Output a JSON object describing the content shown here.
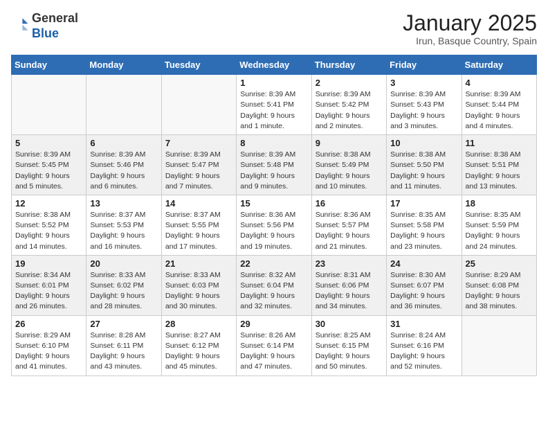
{
  "header": {
    "logo_line1": "General",
    "logo_line2": "Blue",
    "month": "January 2025",
    "location": "Irun, Basque Country, Spain"
  },
  "days_of_week": [
    "Sunday",
    "Monday",
    "Tuesday",
    "Wednesday",
    "Thursday",
    "Friday",
    "Saturday"
  ],
  "weeks": [
    [
      {
        "day": "",
        "info": ""
      },
      {
        "day": "",
        "info": ""
      },
      {
        "day": "",
        "info": ""
      },
      {
        "day": "1",
        "info": "Sunrise: 8:39 AM\nSunset: 5:41 PM\nDaylight: 9 hours\nand 1 minute."
      },
      {
        "day": "2",
        "info": "Sunrise: 8:39 AM\nSunset: 5:42 PM\nDaylight: 9 hours\nand 2 minutes."
      },
      {
        "day": "3",
        "info": "Sunrise: 8:39 AM\nSunset: 5:43 PM\nDaylight: 9 hours\nand 3 minutes."
      },
      {
        "day": "4",
        "info": "Sunrise: 8:39 AM\nSunset: 5:44 PM\nDaylight: 9 hours\nand 4 minutes."
      }
    ],
    [
      {
        "day": "5",
        "info": "Sunrise: 8:39 AM\nSunset: 5:45 PM\nDaylight: 9 hours\nand 5 minutes."
      },
      {
        "day": "6",
        "info": "Sunrise: 8:39 AM\nSunset: 5:46 PM\nDaylight: 9 hours\nand 6 minutes."
      },
      {
        "day": "7",
        "info": "Sunrise: 8:39 AM\nSunset: 5:47 PM\nDaylight: 9 hours\nand 7 minutes."
      },
      {
        "day": "8",
        "info": "Sunrise: 8:39 AM\nSunset: 5:48 PM\nDaylight: 9 hours\nand 9 minutes."
      },
      {
        "day": "9",
        "info": "Sunrise: 8:38 AM\nSunset: 5:49 PM\nDaylight: 9 hours\nand 10 minutes."
      },
      {
        "day": "10",
        "info": "Sunrise: 8:38 AM\nSunset: 5:50 PM\nDaylight: 9 hours\nand 11 minutes."
      },
      {
        "day": "11",
        "info": "Sunrise: 8:38 AM\nSunset: 5:51 PM\nDaylight: 9 hours\nand 13 minutes."
      }
    ],
    [
      {
        "day": "12",
        "info": "Sunrise: 8:38 AM\nSunset: 5:52 PM\nDaylight: 9 hours\nand 14 minutes."
      },
      {
        "day": "13",
        "info": "Sunrise: 8:37 AM\nSunset: 5:53 PM\nDaylight: 9 hours\nand 16 minutes."
      },
      {
        "day": "14",
        "info": "Sunrise: 8:37 AM\nSunset: 5:55 PM\nDaylight: 9 hours\nand 17 minutes."
      },
      {
        "day": "15",
        "info": "Sunrise: 8:36 AM\nSunset: 5:56 PM\nDaylight: 9 hours\nand 19 minutes."
      },
      {
        "day": "16",
        "info": "Sunrise: 8:36 AM\nSunset: 5:57 PM\nDaylight: 9 hours\nand 21 minutes."
      },
      {
        "day": "17",
        "info": "Sunrise: 8:35 AM\nSunset: 5:58 PM\nDaylight: 9 hours\nand 23 minutes."
      },
      {
        "day": "18",
        "info": "Sunrise: 8:35 AM\nSunset: 5:59 PM\nDaylight: 9 hours\nand 24 minutes."
      }
    ],
    [
      {
        "day": "19",
        "info": "Sunrise: 8:34 AM\nSunset: 6:01 PM\nDaylight: 9 hours\nand 26 minutes."
      },
      {
        "day": "20",
        "info": "Sunrise: 8:33 AM\nSunset: 6:02 PM\nDaylight: 9 hours\nand 28 minutes."
      },
      {
        "day": "21",
        "info": "Sunrise: 8:33 AM\nSunset: 6:03 PM\nDaylight: 9 hours\nand 30 minutes."
      },
      {
        "day": "22",
        "info": "Sunrise: 8:32 AM\nSunset: 6:04 PM\nDaylight: 9 hours\nand 32 minutes."
      },
      {
        "day": "23",
        "info": "Sunrise: 8:31 AM\nSunset: 6:06 PM\nDaylight: 9 hours\nand 34 minutes."
      },
      {
        "day": "24",
        "info": "Sunrise: 8:30 AM\nSunset: 6:07 PM\nDaylight: 9 hours\nand 36 minutes."
      },
      {
        "day": "25",
        "info": "Sunrise: 8:29 AM\nSunset: 6:08 PM\nDaylight: 9 hours\nand 38 minutes."
      }
    ],
    [
      {
        "day": "26",
        "info": "Sunrise: 8:29 AM\nSunset: 6:10 PM\nDaylight: 9 hours\nand 41 minutes."
      },
      {
        "day": "27",
        "info": "Sunrise: 8:28 AM\nSunset: 6:11 PM\nDaylight: 9 hours\nand 43 minutes."
      },
      {
        "day": "28",
        "info": "Sunrise: 8:27 AM\nSunset: 6:12 PM\nDaylight: 9 hours\nand 45 minutes."
      },
      {
        "day": "29",
        "info": "Sunrise: 8:26 AM\nSunset: 6:14 PM\nDaylight: 9 hours\nand 47 minutes."
      },
      {
        "day": "30",
        "info": "Sunrise: 8:25 AM\nSunset: 6:15 PM\nDaylight: 9 hours\nand 50 minutes."
      },
      {
        "day": "31",
        "info": "Sunrise: 8:24 AM\nSunset: 6:16 PM\nDaylight: 9 hours\nand 52 minutes."
      },
      {
        "day": "",
        "info": ""
      }
    ]
  ]
}
